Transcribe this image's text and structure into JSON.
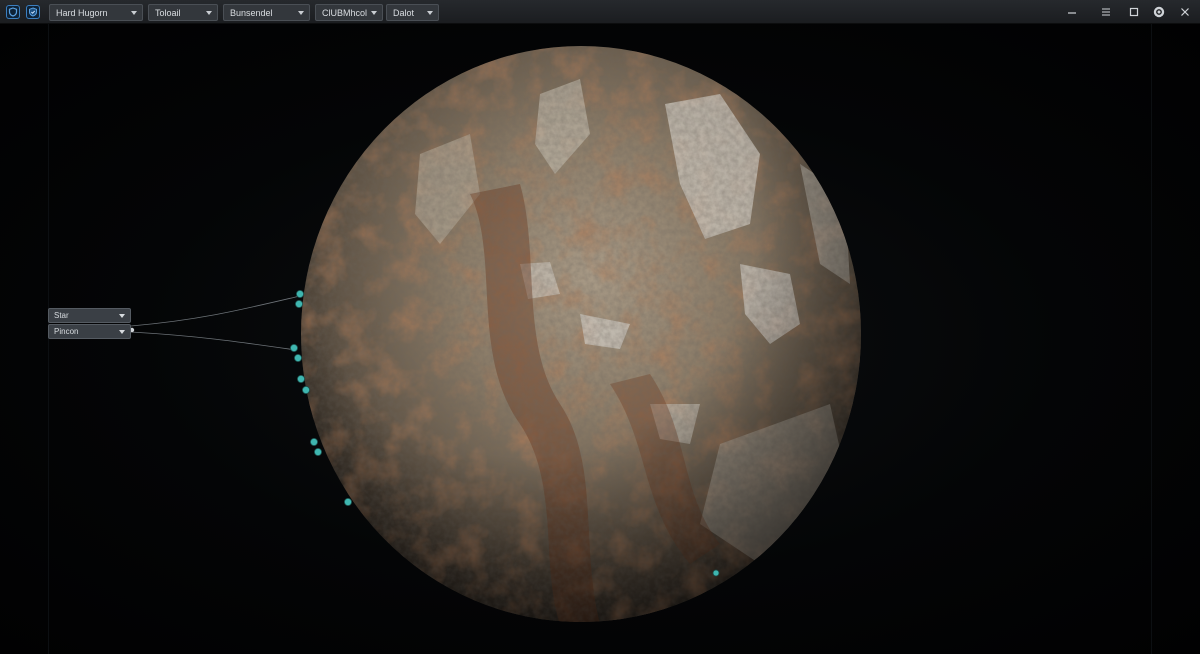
{
  "toolbar": {
    "dropdowns": [
      {
        "label": "Hard Hugorn"
      },
      {
        "label": "Toloail"
      },
      {
        "label": "Bunsendel"
      },
      {
        "label": "ClUBMhcol"
      },
      {
        "label": "Dalot"
      }
    ]
  },
  "window_controls": [
    "minimize-icon",
    "menu-icon",
    "maximize-icon",
    "help-icon",
    "close-icon"
  ],
  "node_panel": {
    "items": [
      {
        "label": "Star"
      },
      {
        "label": "Pincon"
      }
    ]
  },
  "colors": {
    "accent": "#3b7fc0",
    "node_socket": "#3fb6b0",
    "background": "#020304"
  }
}
